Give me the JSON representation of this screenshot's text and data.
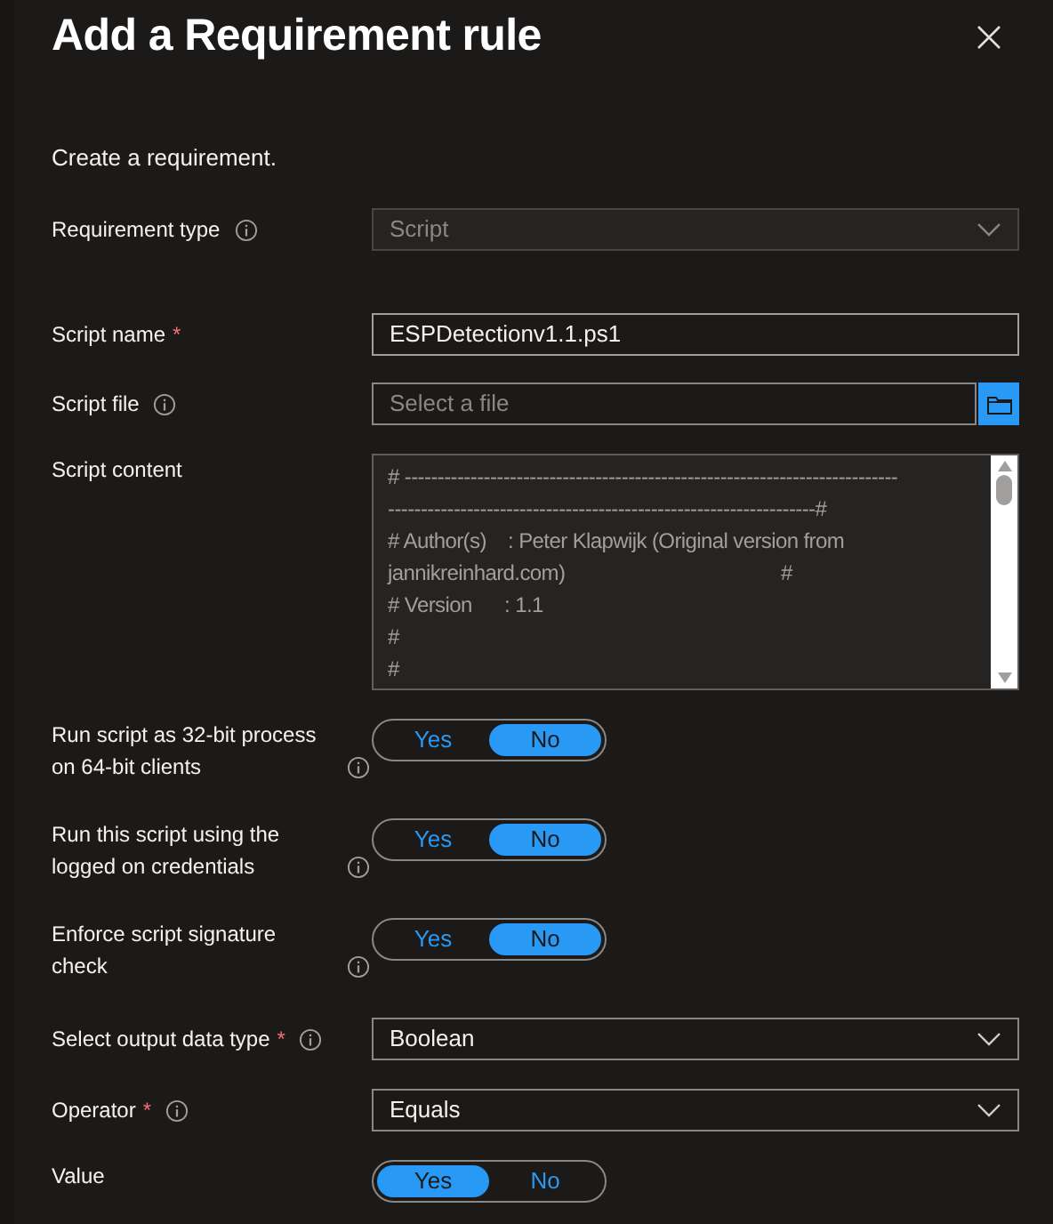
{
  "panel": {
    "title": "Add a Requirement rule",
    "intro": "Create a requirement."
  },
  "fields": [
    {
      "kind": "dropdown",
      "label": "Requirement type",
      "info": true,
      "value": "Script",
      "disabled": true
    },
    {
      "kind": "text",
      "label": "Script name",
      "required_mark": "*",
      "info": false,
      "value": "ESPDetectionv1.1.ps1"
    },
    {
      "kind": "file",
      "label": "Script file",
      "info": true,
      "placeholder": "Select a file"
    },
    {
      "kind": "code",
      "label": "Script content",
      "info": false,
      "lines": [
        "# ---------------------------------------------------------------------------",
        "-----------------------------------------------------------------#",
        "# Author(s)    : Peter Klapwijk (Original version from",
        "jannikreinhard.com)                                        #",
        "# Version      : 1.1",
        "#",
        "#"
      ]
    },
    {
      "kind": "toggle",
      "label": "Run script as 32-bit process on 64-bit clients",
      "info": true,
      "options": [
        {
          "label": "Yes",
          "selected": false
        },
        {
          "label": "No",
          "selected": true
        }
      ]
    },
    {
      "kind": "toggle",
      "label": "Run this script using the logged on credentials",
      "info": true,
      "options": [
        {
          "label": "Yes",
          "selected": false
        },
        {
          "label": "No",
          "selected": true
        }
      ]
    },
    {
      "kind": "toggle",
      "label": "Enforce script signature check",
      "info": true,
      "options": [
        {
          "label": "Yes",
          "selected": false
        },
        {
          "label": "No",
          "selected": true
        }
      ]
    },
    {
      "kind": "dropdown",
      "label": "Select output data type",
      "required_mark": "*",
      "info": true,
      "value": "Boolean",
      "disabled": false
    },
    {
      "kind": "dropdown",
      "label": "Operator",
      "required_mark": "*",
      "info": true,
      "value": "Equals",
      "disabled": false
    },
    {
      "kind": "toggle",
      "label": "Value",
      "info": false,
      "options": [
        {
          "label": "Yes",
          "selected": true
        },
        {
          "label": "No",
          "selected": false
        }
      ]
    }
  ]
}
